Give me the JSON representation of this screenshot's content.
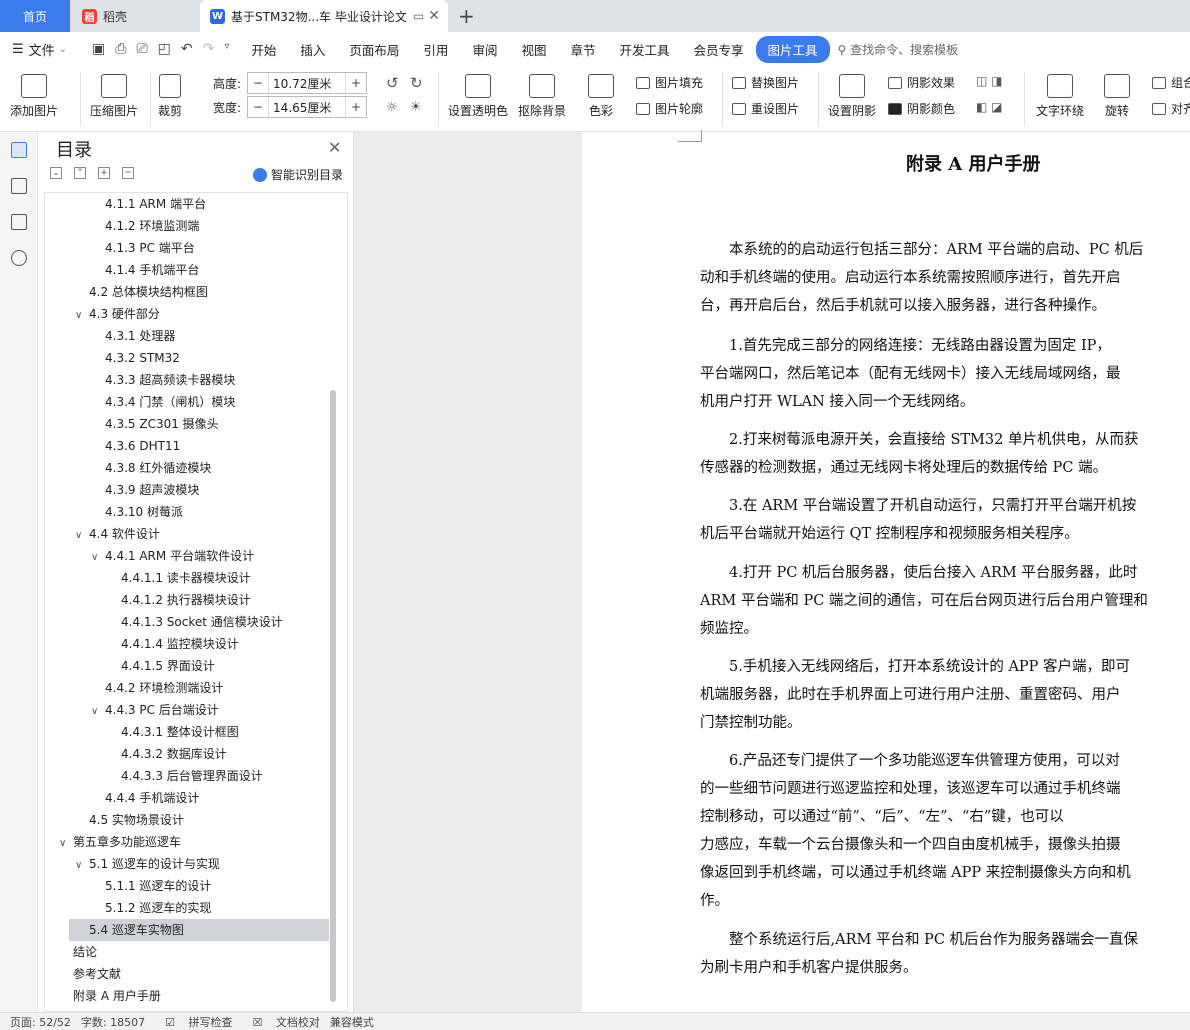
{
  "tabs": {
    "home": "首页",
    "docer": "稻壳",
    "doc": "基于STM32物...车 毕业设计论文"
  },
  "menu": {
    "file": "文件",
    "items": [
      "开始",
      "插入",
      "页面布局",
      "引用",
      "审阅",
      "视图",
      "章节",
      "开发工具",
      "会员专享"
    ],
    "active": "图片工具",
    "search": "查找命令、搜索模板"
  },
  "ribbon": {
    "add_picture": "添加图片",
    "compress": "压缩图片",
    "crop": "裁剪",
    "height_label": "高度:",
    "height_value": "10.72厘米",
    "width_label": "宽度:",
    "width_value": "14.65厘米",
    "transparent": "设置透明色",
    "remove_bg": "抠除背景",
    "color": "色彩",
    "fill": "图片填充",
    "outline": "图片轮廓",
    "replace": "替换图片",
    "reset": "重设图片",
    "shadow": "设置阴影",
    "shadow_effect": "阴影效果",
    "shadow_color": "阴影颜色",
    "wrap": "文字环绕",
    "rotate": "旋转",
    "group": "组合",
    "align": "对齐"
  },
  "nav": {
    "title": "目录",
    "smart": "智能识别目录",
    "items": [
      "4.1.1 ARM 端平台",
      "4.1.2 环境监测端",
      "4.1.3 PC 端平台",
      "4.1.4 手机端平台",
      "4.2 总体模块结构框图",
      "4.3 硬件部分",
      "4.3.1 处理器",
      "4.3.2 STM32",
      "4.3.3 超高频读卡器模块",
      "4.3.4 门禁（闸机）模块",
      "4.3.5 ZC301 摄像头",
      "4.3.6 DHT11",
      "4.3.8 红外循迹模块",
      "4.3.9 超声波模块",
      "4.3.10 树莓派",
      "4.4 软件设计",
      "4.4.1 ARM 平台端软件设计",
      "4.4.1.1 读卡器模块设计",
      "4.4.1.2 执行器模块设计",
      "4.4.1.3 Socket 通信模块设计",
      "4.4.1.4 监控模块设计",
      "4.4.1.5 界面设计",
      "4.4.2 环境检测端设计",
      "4.4.3 PC 后台端设计",
      "4.4.3.1 整体设计框图",
      "4.4.3.2 数据库设计",
      "4.4.3.3 后台管理界面设计",
      "4.4.4 手机端设计",
      "4.5 实物场景设计",
      "第五章多功能巡逻车",
      "5.1 巡逻车的设计与实现",
      "5.1.1 巡逻车的设计",
      "5.1.2 巡逻车的实现",
      "5.4 巡逻车实物图",
      "结论",
      "参考文献",
      "附录 A 用户手册"
    ]
  },
  "doc": {
    "title": "附录 A 用户手册",
    "paragraphs": [
      [
        "　　本系统的的启动运行包括三部分：ARM 平台端的启动、PC 机后",
        "动和手机终端的使用。启动运行本系统需按照顺序进行，首先开启",
        "台，再开启后台，然后手机就可以接入服务器，进行各种操作。"
      ],
      [
        "　　1.首先完成三部分的网络连接：无线路由器设置为固定 IP，",
        "平台端网口，然后笔记本（配有无线网卡）接入无线局域网络，最",
        "机用户打开 WLAN 接入同一个无线网络。"
      ],
      [
        "　　2.打来树莓派电源开关，会直接给 STM32 单片机供电，从而获",
        "传感器的检测数据，通过无线网卡将处理后的数据传给 PC 端。"
      ],
      [
        "　　3.在 ARM 平台端设置了开机自动运行，只需打开平台端开机按",
        "机后平台端就开始运行 QT 控制程序和视频服务相关程序。"
      ],
      [
        "　　4.打开 PC 机后台服务器，使后台接入 ARM 平台服务器，此时",
        "ARM 平台端和 PC 端之间的通信，可在后台网页进行后台用户管理和",
        "频监控。"
      ],
      [
        "　　5.手机接入无线网络后，打开本系统设计的 APP 客户端，即可",
        "机端服务器，此时在手机界面上可进行用户注册、重置密码、用户",
        "门禁控制功能。"
      ],
      [
        "　　6.产品还专门提供了一个多功能巡逻车供管理方使用，可以对",
        "的一些细节问题进行巡逻监控和处理，该巡逻车可以通过手机终端",
        "控制移动，可以通过“前”、“后”、“左”、“右”键，也可以",
        "力感应，车载一个云台摄像头和一个四自由度机械手，摄像头拍摄",
        "像返回到手机终端，可以通过手机终端 APP 来控制摄像头方向和机",
        "作。"
      ],
      [
        "　　整个系统运行后,ARM 平台和 PC 机后台作为服务器端会一直保",
        "为刷卡用户和手机客户提供服务。"
      ]
    ]
  },
  "status": {
    "page": "页面: 52/52",
    "words": "字数: 18507",
    "spell": "拼写检查",
    "proof": "文档校对",
    "compat": "兼容模式"
  }
}
